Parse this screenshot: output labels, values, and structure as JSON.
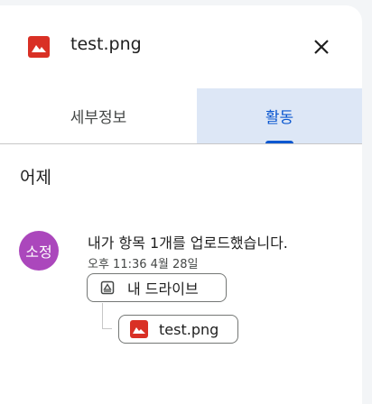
{
  "header": {
    "file_name": "test.png",
    "file_icon": "image-file-icon",
    "close_icon": "close-icon"
  },
  "tabs": [
    {
      "label": "세부정보",
      "selected": false
    },
    {
      "label": "활동",
      "selected": true
    }
  ],
  "activity": {
    "section_title": "어제",
    "avatar_text": "소정",
    "avatar_color": "#ab47bc",
    "action_text": "내가 항목 1개를 업로드했습니다.",
    "timestamp": "오후 11:36 4월 28일",
    "location_chip": {
      "label": "내 드라이브",
      "icon": "drive-icon"
    },
    "file_chip": {
      "label": "test.png",
      "icon": "image-file-icon"
    }
  },
  "colors": {
    "accent": "#0b57d0",
    "selected_tab_bg": "#dde7f6",
    "image_icon": "#d93025"
  }
}
